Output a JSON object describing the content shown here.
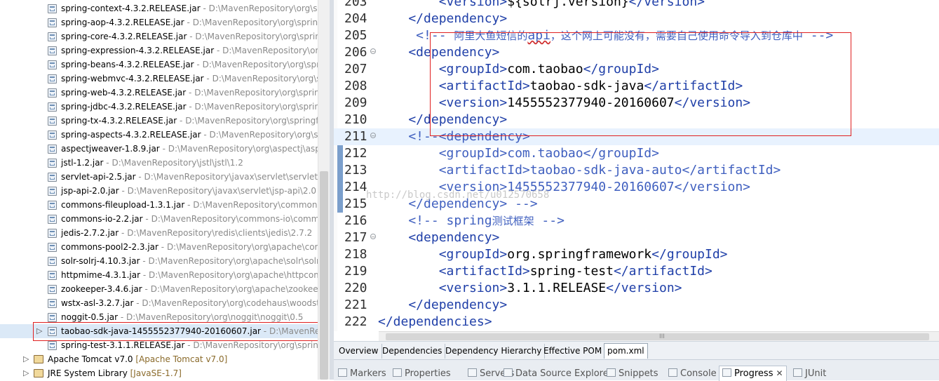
{
  "tree": {
    "jars": [
      {
        "name": "spring-context-4.3.2.RELEASE.jar",
        "path": "D:\\MavenRepository\\org\\spring"
      },
      {
        "name": "spring-aop-4.3.2.RELEASE.jar",
        "path": "D:\\MavenRepository\\org\\spring"
      },
      {
        "name": "spring-core-4.3.2.RELEASE.jar",
        "path": "D:\\MavenRepository\\org\\spring"
      },
      {
        "name": "spring-expression-4.3.2.RELEASE.jar",
        "path": "D:\\MavenRepository\\org"
      },
      {
        "name": "spring-beans-4.3.2.RELEASE.jar",
        "path": "D:\\MavenRepository\\org\\spring"
      },
      {
        "name": "spring-webmvc-4.3.2.RELEASE.jar",
        "path": "D:\\MavenRepository\\org\\sp"
      },
      {
        "name": "spring-web-4.3.2.RELEASE.jar",
        "path": "D:\\MavenRepository\\org\\spring"
      },
      {
        "name": "spring-jdbc-4.3.2.RELEASE.jar",
        "path": "D:\\MavenRepository\\org\\spring"
      },
      {
        "name": "spring-tx-4.3.2.RELEASE.jar",
        "path": "D:\\MavenRepository\\org\\springfr"
      },
      {
        "name": "spring-aspects-4.3.2.RELEASE.jar",
        "path": "D:\\MavenRepository\\org\\sp"
      },
      {
        "name": "aspectjweaver-1.8.9.jar",
        "path": "D:\\MavenRepository\\org\\aspectj\\aspe"
      },
      {
        "name": "jstl-1.2.jar",
        "path": "D:\\MavenRepository\\jstl\\jstl\\1.2"
      },
      {
        "name": "servlet-api-2.5.jar",
        "path": "D:\\MavenRepository\\javax\\servlet\\servlet-a"
      },
      {
        "name": "jsp-api-2.0.jar",
        "path": "D:\\MavenRepository\\javax\\servlet\\jsp-api\\2.0"
      },
      {
        "name": "commons-fileupload-1.3.1.jar",
        "path": "D:\\MavenRepository\\commons"
      },
      {
        "name": "commons-io-2.2.jar",
        "path": "D:\\MavenRepository\\commons-io\\comm"
      },
      {
        "name": "jedis-2.7.2.jar",
        "path": "D:\\MavenRepository\\redis\\clients\\jedis\\2.7.2"
      },
      {
        "name": "commons-pool2-2.3.jar",
        "path": "D:\\MavenRepository\\org\\apache\\cor"
      },
      {
        "name": "solr-solrj-4.10.3.jar",
        "path": "D:\\MavenRepository\\org\\apache\\solr\\solr"
      },
      {
        "name": "httpmime-4.3.1.jar",
        "path": "D:\\MavenRepository\\org\\apache\\httpcom"
      },
      {
        "name": "zookeeper-3.4.6.jar",
        "path": "D:\\MavenRepository\\org\\apache\\zookee"
      },
      {
        "name": "wstx-asl-3.2.7.jar",
        "path": "D:\\MavenRepository\\org\\codehaus\\woodsto"
      },
      {
        "name": "noggit-0.5.jar",
        "path": "D:\\MavenRepository\\org\\noggit\\noggit\\0.5"
      },
      {
        "name": "taobao-sdk-java-1455552377940-20160607.jar",
        "path": "D:\\MavenRepo"
      },
      {
        "name": "spring-test-3.1.1.RELEASE.jar",
        "path": "D:\\MavenRepository\\org\\spring"
      }
    ],
    "separator": " - ",
    "libs": [
      {
        "name": "Apache Tomcat v7.0",
        "ver": "[Apache Tomcat v7.0]"
      },
      {
        "name": "JRE System Library",
        "ver": "[JavaSE-1.7]"
      }
    ]
  },
  "editor": {
    "lines": [
      {
        "n": "203",
        "code": [
          [
            "t",
            "        <version>"
          ],
          [
            "tx",
            "${solrj.version}"
          ],
          [
            "t",
            "</version>"
          ]
        ]
      },
      {
        "n": "204",
        "code": [
          [
            "t",
            "    </dependency>"
          ]
        ]
      },
      {
        "n": "205",
        "code": [
          [
            "c",
            "     <!-- "
          ],
          [
            "cz",
            "阿里大鱼短信的"
          ],
          [
            "c",
            "api"
          ],
          [
            "cz",
            "，这个网上可能没有，需要自己使用命令导入到仓库中"
          ],
          [
            "c",
            " -->"
          ]
        ]
      },
      {
        "n": "206",
        "fold": true,
        "code": [
          [
            "t",
            "    <dependency>"
          ]
        ]
      },
      {
        "n": "207",
        "code": [
          [
            "t",
            "        <groupId>"
          ],
          [
            "tx",
            "com.taobao"
          ],
          [
            "t",
            "</groupId>"
          ]
        ]
      },
      {
        "n": "208",
        "code": [
          [
            "t",
            "        <artifactId>"
          ],
          [
            "tx",
            "taobao-sdk-java"
          ],
          [
            "t",
            "</artifactId>"
          ]
        ]
      },
      {
        "n": "209",
        "code": [
          [
            "t",
            "        <version>"
          ],
          [
            "tx",
            "1455552377940-20160607"
          ],
          [
            "t",
            "</version>"
          ]
        ]
      },
      {
        "n": "210",
        "code": [
          [
            "t",
            "    </dependency>"
          ]
        ]
      },
      {
        "n": "211",
        "fold": true,
        "cur": true,
        "code": [
          [
            "c",
            "    <!--<dependency>"
          ]
        ]
      },
      {
        "n": "212",
        "code": [
          [
            "c",
            "        <groupId>com.taobao</groupId>"
          ]
        ]
      },
      {
        "n": "213",
        "code": [
          [
            "c",
            "        <artifactId>taobao-sdk-java-auto</artifactId>"
          ]
        ]
      },
      {
        "n": "214",
        "code": [
          [
            "c",
            "        <version>1455552377940-20160607</version>"
          ]
        ]
      },
      {
        "n": "215",
        "code": [
          [
            "c",
            "    </dependency> -->"
          ]
        ]
      },
      {
        "n": "216",
        "code": [
          [
            "c",
            "    <!-- spring"
          ],
          [
            "cz",
            "测试框架"
          ],
          [
            "c",
            " -->"
          ]
        ]
      },
      {
        "n": "217",
        "fold": true,
        "code": [
          [
            "t",
            "    <dependency>"
          ]
        ]
      },
      {
        "n": "218",
        "code": [
          [
            "t",
            "        <groupId>"
          ],
          [
            "tx",
            "org.springframework"
          ],
          [
            "t",
            "</groupId>"
          ]
        ]
      },
      {
        "n": "219",
        "code": [
          [
            "t",
            "        <artifactId>"
          ],
          [
            "tx",
            "spring-test"
          ],
          [
            "t",
            "</artifactId>"
          ]
        ]
      },
      {
        "n": "220",
        "code": [
          [
            "t",
            "        <version>"
          ],
          [
            "tx",
            "3.1.1.RELEASE"
          ],
          [
            "t",
            "</version>"
          ]
        ]
      },
      {
        "n": "221",
        "code": [
          [
            "t",
            "    </dependency>"
          ]
        ]
      },
      {
        "n": "222",
        "code": [
          [
            "t",
            "</dependencies>"
          ]
        ]
      }
    ],
    "watermark": "http://blog.csdn.net/u012570658",
    "hscroll_grip": "III"
  },
  "pom_tabs": [
    "Overview",
    "Dependencies",
    "Dependency Hierarchy",
    "Effective POM",
    "pom.xml"
  ],
  "bottom_tabs": [
    "Markers",
    "Properties",
    "Servers",
    "Data Source Explorer",
    "Snippets",
    "Console",
    "Progress",
    "JUnit"
  ],
  "icons": {
    "jar": "jar-file-icon",
    "lib": "library-icon",
    "close": "close-icon"
  }
}
